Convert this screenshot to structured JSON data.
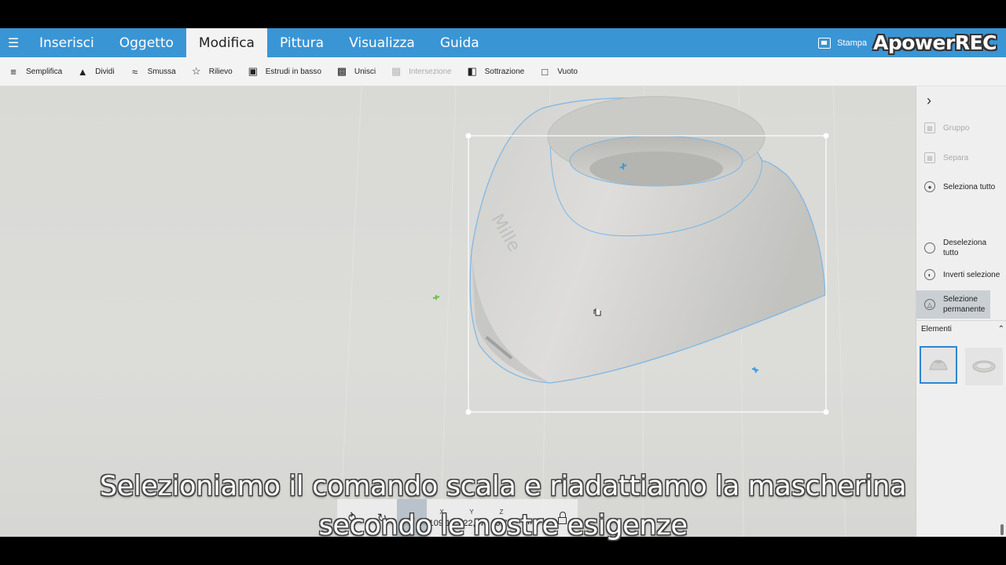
{
  "menubar": {
    "items": [
      {
        "label": "Inserisci"
      },
      {
        "label": "Oggetto"
      },
      {
        "label": "Modifica"
      },
      {
        "label": "Pittura"
      },
      {
        "label": "Visualizza"
      },
      {
        "label": "Guida"
      }
    ],
    "active_item": "Modifica",
    "print_label": "Stampa",
    "watermark": "ApowerREC",
    "accent_color": "#3a95d5"
  },
  "toolbar": {
    "tools": [
      {
        "label": "Semplifica",
        "icon": "simplify-icon",
        "enabled": true
      },
      {
        "label": "Dividi",
        "icon": "split-icon",
        "enabled": true
      },
      {
        "label": "Smussa",
        "icon": "smooth-icon",
        "enabled": true
      },
      {
        "label": "Rilievo",
        "icon": "emboss-icon",
        "enabled": true
      },
      {
        "label": "Estrudi in basso",
        "icon": "extrude-down-icon",
        "enabled": true
      },
      {
        "label": "Unisci",
        "icon": "merge-icon",
        "enabled": true
      },
      {
        "label": "Intersezione",
        "icon": "intersect-icon",
        "enabled": false
      },
      {
        "label": "Sottrazione",
        "icon": "subtract-icon",
        "enabled": true
      },
      {
        "label": "Vuoto",
        "icon": "hollow-icon",
        "enabled": true
      }
    ]
  },
  "right_panel": {
    "items": [
      {
        "label": "Gruppo",
        "icon": "group-icon",
        "enabled": false
      },
      {
        "label": "Separa",
        "icon": "ungroup-icon",
        "enabled": false
      },
      {
        "label": "Seleziona tutto",
        "icon": "select-all-icon",
        "enabled": true
      },
      {
        "label": "Deseleziona tutto",
        "icon": "deselect-all-icon",
        "enabled": true
      },
      {
        "label": "Inverti selezione",
        "icon": "invert-selection-icon",
        "enabled": true
      },
      {
        "label": "Selezione permanente",
        "icon": "sticky-selection-icon",
        "enabled": true,
        "active": true
      }
    ],
    "section_label": "Elementi",
    "elements": [
      {
        "name": "mask-body",
        "selected": true
      },
      {
        "name": "ring",
        "selected": false
      }
    ]
  },
  "transform_bar": {
    "x": {
      "axis": "X",
      "value": "109,11"
    },
    "y": {
      "axis": "Y",
      "value": "122,57"
    },
    "z": {
      "axis": "Z",
      "value": "43,77"
    },
    "unit": "mm",
    "active_tool": "scale"
  },
  "subtitles": {
    "line1": "Selezioniamo il comando scala e riadattiamo la mascherina",
    "line2": "secondo le nostre esigenze"
  }
}
